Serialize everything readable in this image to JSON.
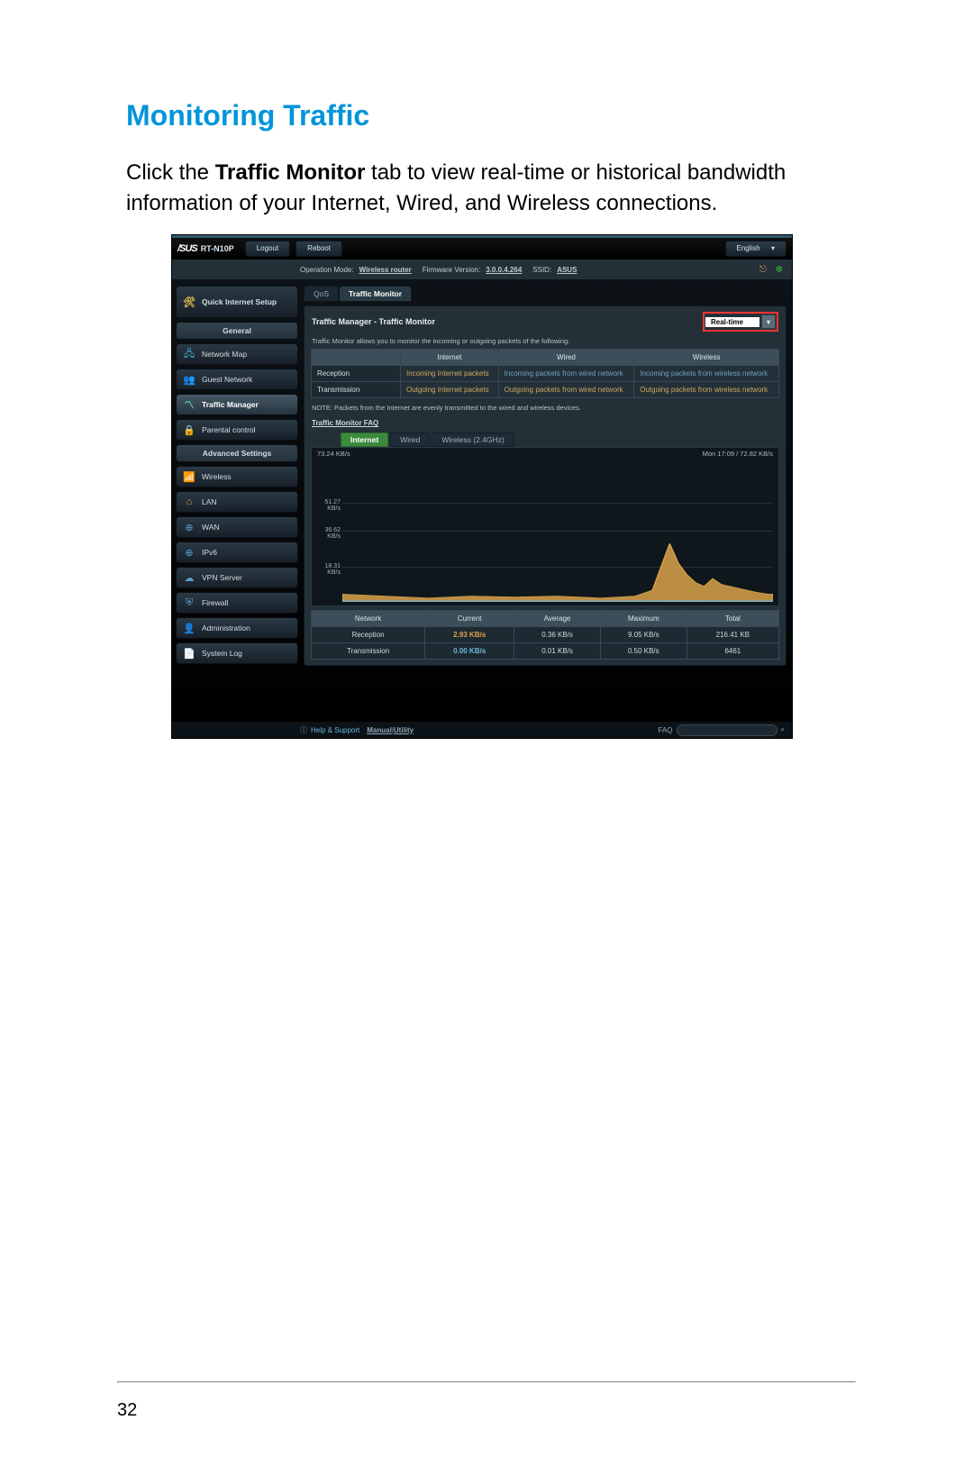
{
  "page": {
    "title": "Monitoring Traffic",
    "intro_lead": "Click the ",
    "intro_bold": "Traffic Monitor",
    "intro_tail": " tab to view real-time or historical bandwidth information of your Internet, Wired, and Wireless connections.",
    "number": "32"
  },
  "header": {
    "brand": "/SUS",
    "model": "RT-N10P",
    "logout": "Logout",
    "reboot": "Reboot",
    "language": "English"
  },
  "status": {
    "opmode_label": "Operation Mode:",
    "opmode_link": "Wireless router",
    "fw_label": "Firmware Version:",
    "fw_link": "3.0.0.4.264",
    "ssid_label": "SSID:",
    "ssid_value": "ASUS"
  },
  "sidebar": {
    "quick_setup": "Quick Internet Setup",
    "general": "General",
    "items_general": [
      {
        "label": "Network Map",
        "icon": "🖧",
        "c": "#3db0cf"
      },
      {
        "label": "Guest Network",
        "icon": "👥",
        "c": "#3db0cf"
      },
      {
        "label": "Traffic Manager",
        "icon": "〽",
        "c": "#66e0c8"
      },
      {
        "label": "Parental control",
        "icon": "🔒",
        "c": "#49c4c4"
      }
    ],
    "advanced": "Advanced Settings",
    "items_adv": [
      {
        "label": "Wireless",
        "icon": "📶",
        "c": "#49c4c4"
      },
      {
        "label": "LAN",
        "icon": "⌂",
        "c": "#d9a24a"
      },
      {
        "label": "WAN",
        "icon": "⊕",
        "c": "#58a3d6"
      },
      {
        "label": "IPv6",
        "icon": "⊕",
        "c": "#58a3d6"
      },
      {
        "label": "VPN Server",
        "icon": "☁",
        "c": "#58a3d6"
      },
      {
        "label": "Firewall",
        "icon": "⛨",
        "c": "#58a3d6"
      },
      {
        "label": "Administration",
        "icon": "👤",
        "c": "#58a3d6"
      },
      {
        "label": "System Log",
        "icon": "📄",
        "c": "#58a3d6"
      }
    ]
  },
  "content": {
    "tabs": [
      "QoS",
      "Traffic Monitor"
    ],
    "tab_active": 1,
    "panel_title": "Traffic Manager - Traffic Monitor",
    "realtime": "Real-time",
    "desc": "Traffic Monitor allows you to monitor the incoming or outgoing packets of the following:",
    "cols": [
      "Internet",
      "Wired",
      "Wireless"
    ],
    "rows": [
      {
        "h": "Reception",
        "cells": [
          "Incoming Internet packets",
          "Incoming packets from wired network",
          "Incoming packets from wireless network"
        ]
      },
      {
        "h": "Transmission",
        "cells": [
          "Outgoing Internet packets",
          "Outgoing packets from wired network",
          "Outgoing packets from wireless network"
        ]
      }
    ],
    "note": "NOTE: Packets from the Internet are evenly transmitted to the wired and wireless devices.",
    "faq_link": "Traffic Monitor FAQ",
    "chart_tabs": [
      "Internet",
      "Wired",
      "Wireless (2.4GHz)"
    ],
    "chart_tab_active": 0,
    "chart_top_left": "73.24 KB/s",
    "chart_top_right": "Mon 17:09 / 72.82 KB/s",
    "yticks": [
      "51.27 KB/s",
      "36.62 KB/s",
      "18.31 KB/s"
    ],
    "stats_cols": [
      "Network",
      "Current",
      "Average",
      "Maximum",
      "Total"
    ],
    "stats": [
      {
        "h": "Reception",
        "cells": [
          "2.93 KB/s",
          "0.36 KB/s",
          "9.05 KB/s",
          "216.41 KB"
        ],
        "cls": "hl-o"
      },
      {
        "h": "Transmission",
        "cells": [
          "0.00 KB/s",
          "0.01 KB/s",
          "0.50 KB/s",
          "6461"
        ],
        "cls": "hl-b"
      }
    ]
  },
  "footer": {
    "help": "Help & Support",
    "manual": "Manual",
    "sep": " | ",
    "utility": "Utility",
    "faq": "FAQ"
  },
  "chart_data": {
    "type": "line",
    "title": "Internet traffic (KB/s)",
    "ylabel": "KB/s",
    "ylim": [
      0,
      73.24
    ],
    "x_range": [
      0,
      100
    ],
    "series": [
      {
        "name": "Reception",
        "color": "#d9a24a",
        "points": [
          [
            0,
            4
          ],
          [
            10,
            3
          ],
          [
            20,
            2
          ],
          [
            30,
            3
          ],
          [
            40,
            2.5
          ],
          [
            50,
            3
          ],
          [
            60,
            2
          ],
          [
            68,
            3
          ],
          [
            72,
            6
          ],
          [
            74,
            18
          ],
          [
            76,
            30
          ],
          [
            78,
            20
          ],
          [
            80,
            14
          ],
          [
            82,
            10
          ],
          [
            84,
            8
          ],
          [
            86,
            12
          ],
          [
            88,
            9
          ],
          [
            92,
            7
          ],
          [
            96,
            5
          ],
          [
            99,
            4
          ],
          [
            100,
            4
          ]
        ]
      },
      {
        "name": "Transmission",
        "color": "#6fb7d8",
        "points": [
          [
            0,
            0.5
          ],
          [
            30,
            0.5
          ],
          [
            60,
            0.5
          ],
          [
            80,
            0.6
          ],
          [
            100,
            0.5
          ]
        ]
      }
    ]
  }
}
